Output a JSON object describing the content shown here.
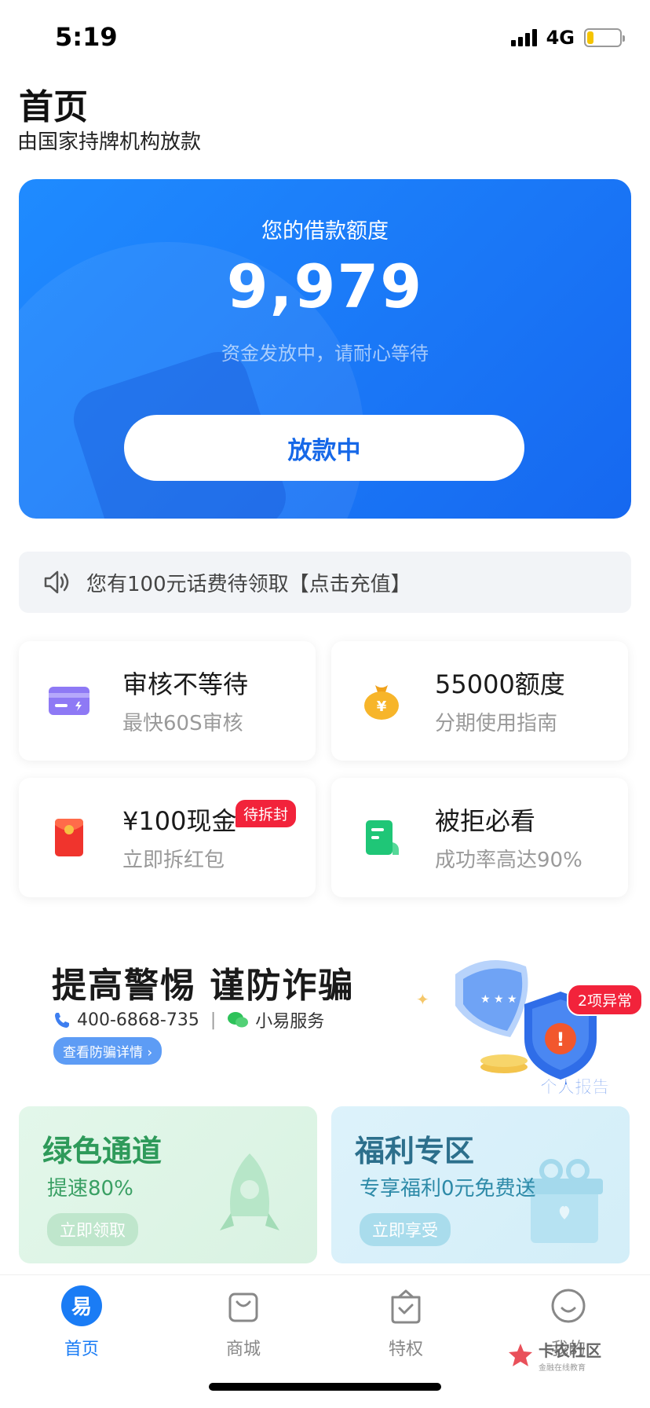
{
  "status_bar": {
    "time": "5:19",
    "network": "4G",
    "battery_level": 0.2
  },
  "header": {
    "title": "首页",
    "subtitle": "由国家持牌机构放款"
  },
  "hero": {
    "label": "您的借款额度",
    "amount": "9,979",
    "note": "资金发放中，请耐心等待",
    "button": "放款中"
  },
  "notice": {
    "text": "您有100元话费待领取【点击充值】",
    "icon": "speaker-icon"
  },
  "grid": [
    {
      "title": "审核不等待",
      "sub": "最快60S审核",
      "icon": "credit-card-icon"
    },
    {
      "title": "55000额度",
      "sub": "分期使用指南",
      "icon": "money-bag-icon"
    },
    {
      "title": "¥100现金",
      "sub": "立即拆红包",
      "icon": "red-envelope-icon",
      "tag": "待拆封"
    },
    {
      "title": "被拒必看",
      "sub": "成功率高达90%",
      "icon": "document-icon"
    }
  ],
  "fraud": {
    "title": "提高警惕 谨防诈骗",
    "phone": "400-6868-735",
    "wechat": "小易服务",
    "link": "查看防骗详情 ›",
    "alert_tag": "2项异常",
    "report_label": "个人报告"
  },
  "promos": [
    {
      "title": "绿色通道",
      "sub": "提速80%",
      "button": "立即领取"
    },
    {
      "title": "福利专区",
      "sub": "专享福利0元免费送",
      "button": "立即享受"
    }
  ],
  "tabs": [
    {
      "label": "首页",
      "active": true
    },
    {
      "label": "商城",
      "active": false
    },
    {
      "label": "特权",
      "active": false
    },
    {
      "label": "我的",
      "active": false
    }
  ],
  "watermark": {
    "text": "卡农社区",
    "sub": "金融在线教育"
  },
  "colors": {
    "primary": "#1a7cf5",
    "alert": "#f2233b",
    "green": "#2e9a5a"
  }
}
